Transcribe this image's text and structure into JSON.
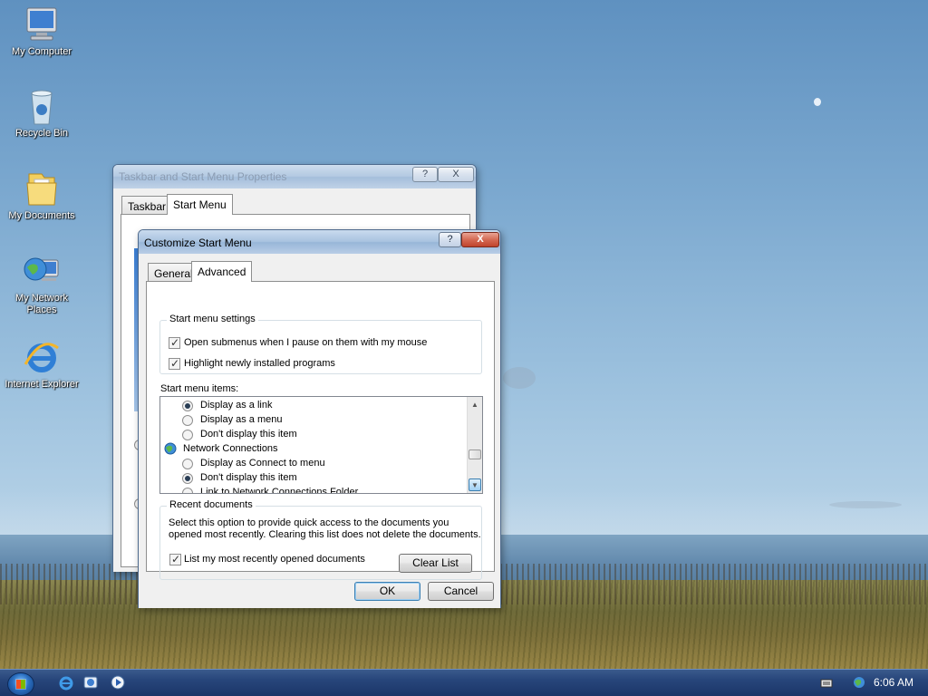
{
  "desktop": {
    "icons": [
      {
        "label": "My Computer",
        "icon": "computer-icon"
      },
      {
        "label": "Recycle Bin",
        "icon": "recycle-bin-icon"
      },
      {
        "label": "My Documents",
        "icon": "folder-icon"
      },
      {
        "label": "My Network Places",
        "icon": "network-icon"
      },
      {
        "label": "Internet Explorer",
        "icon": "internet-explorer-icon"
      }
    ]
  },
  "back_window": {
    "title": "Taskbar and Start Menu Properties",
    "tabs": [
      "Taskbar",
      "Start Menu"
    ],
    "active_tab": "Start Menu"
  },
  "dialog": {
    "title": "Customize Start Menu",
    "tabs": [
      "General",
      "Advanced"
    ],
    "active_tab": "Advanced",
    "settings_group": {
      "label": "Start menu settings",
      "options": [
        {
          "label": "Open submenus when I pause on them with my mouse",
          "checked": true
        },
        {
          "label": "Highlight newly installed programs",
          "checked": true
        }
      ]
    },
    "items_label": "Start menu items:",
    "items": [
      {
        "kind": "radio",
        "label": "Display as a link",
        "selected": true
      },
      {
        "kind": "radio",
        "label": "Display as a menu",
        "selected": false
      },
      {
        "kind": "radio",
        "label": "Don't display this item",
        "selected": false
      },
      {
        "kind": "header",
        "label": "Network Connections",
        "icon": "network-connections-icon"
      },
      {
        "kind": "radio",
        "label": "Display as Connect to menu",
        "selected": false
      },
      {
        "kind": "radio",
        "label": "Don't display this item",
        "selected": true
      },
      {
        "kind": "radio",
        "label": "Link to Network Connections Folder",
        "selected": false
      }
    ],
    "recent_group": {
      "label": "Recent documents",
      "description_line1": "Select this option to provide quick access to the documents you",
      "description_line2": "opened most recently.  Clearing this list does not delete the documents.",
      "checkbox_label": "List my most recently opened documents",
      "checked": true,
      "clear_button": "Clear List"
    },
    "ok_button": "OK",
    "cancel_button": "Cancel",
    "help_glyph": "?",
    "close_glyph": "X"
  },
  "taskbar": {
    "time": "6:06 AM",
    "quick_launch": [
      "internet-explorer-icon",
      "outlook-express-icon",
      "media-player-icon"
    ],
    "tray": [
      "keyboard-icon",
      "network-tray-icon"
    ]
  }
}
